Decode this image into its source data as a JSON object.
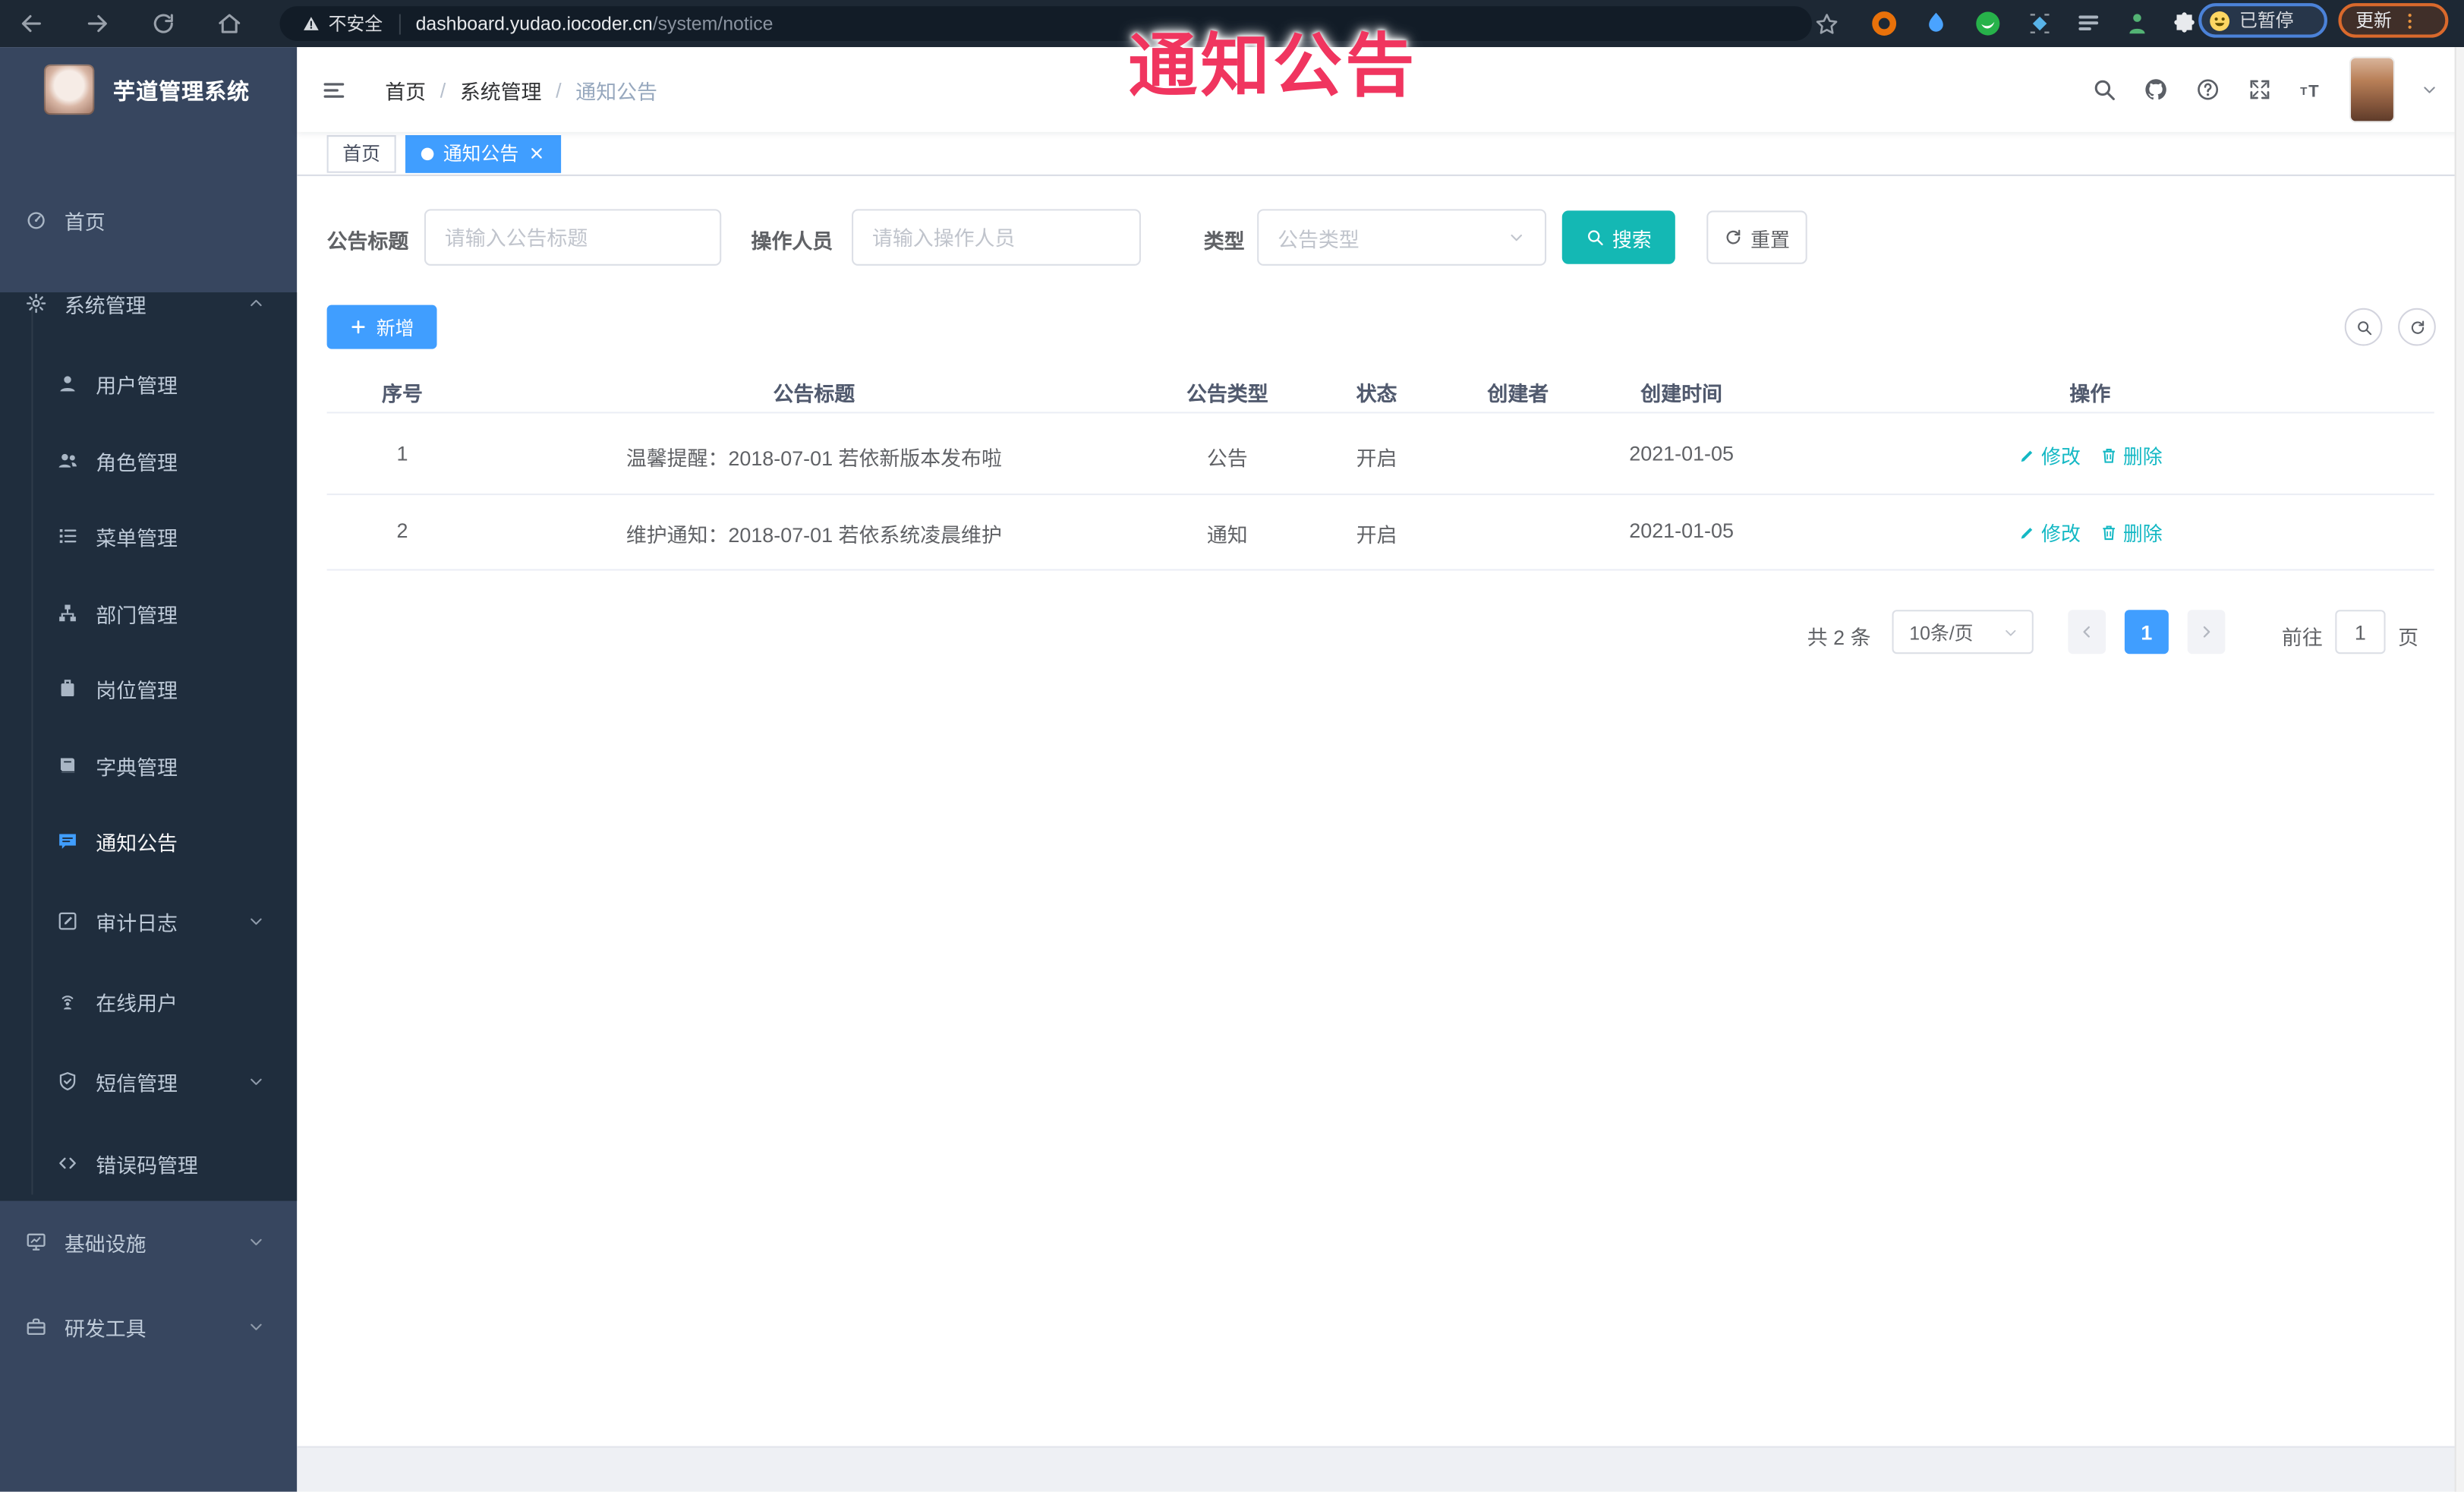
{
  "browser": {
    "security_text": "不安全",
    "url_domain": "dashboard.yudao.iocoder.cn",
    "url_path": "/system/notice",
    "paused_badge": "已暂停",
    "update_label": "更新",
    "extension_on_badge": "on"
  },
  "overlay": {
    "title": "通知公告"
  },
  "sidebar": {
    "app_title": "芋道管理系统",
    "home": {
      "label": "首页"
    },
    "system": {
      "label": "系统管理"
    },
    "system_children": [
      {
        "label": "用户管理"
      },
      {
        "label": "角色管理"
      },
      {
        "label": "菜单管理"
      },
      {
        "label": "部门管理"
      },
      {
        "label": "岗位管理"
      },
      {
        "label": "字典管理"
      },
      {
        "label": "通知公告",
        "active": true
      },
      {
        "label": "审计日志",
        "collapsible": true
      },
      {
        "label": "在线用户"
      },
      {
        "label": "短信管理",
        "collapsible": true
      },
      {
        "label": "错误码管理"
      }
    ],
    "infra": {
      "label": "基础设施"
    },
    "devtools": {
      "label": "研发工具"
    }
  },
  "header": {
    "breadcrumb": [
      "首页",
      "系统管理",
      "通知公告"
    ],
    "separator": "/"
  },
  "tabs": [
    {
      "label": "首页"
    },
    {
      "label": "通知公告"
    }
  ],
  "filters": {
    "title_label": "公告标题",
    "title_placeholder": "请输入公告标题",
    "operator_label": "操作人员",
    "operator_placeholder": "请输入操作人员",
    "type_label": "类型",
    "type_placeholder": "公告类型",
    "search_label": "搜索",
    "reset_label": "重置"
  },
  "actions_bar": {
    "add_label": "新增"
  },
  "table": {
    "headers": [
      "序号",
      "公告标题",
      "公告类型",
      "状态",
      "创建者",
      "创建时间",
      "操作"
    ],
    "rows": [
      {
        "no": "1",
        "title": "温馨提醒：2018-07-01 若依新版本发布啦",
        "type": "公告",
        "status": "开启",
        "creator": "",
        "created": "2021-01-05"
      },
      {
        "no": "2",
        "title": "维护通知：2018-07-01 若依系统凌晨维护",
        "type": "通知",
        "status": "开启",
        "creator": "",
        "created": "2021-01-05"
      }
    ],
    "edit_label": "修改",
    "delete_label": "删除"
  },
  "pagination": {
    "total": "共 2 条",
    "page_size": "10条/页",
    "current_page": "1",
    "goto_label": "前往",
    "goto_value": "1",
    "page_unit": "页"
  },
  "colors": {
    "primary": "#409eff",
    "cyan": "#14b8b4",
    "overlay_red": "#f0355f",
    "sidebar_bg": "#37465f",
    "submenu_bg": "#1f2d3d"
  }
}
